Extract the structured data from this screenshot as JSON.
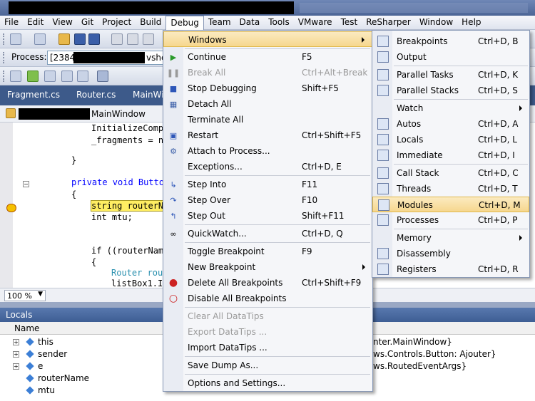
{
  "menubar": [
    "File",
    "Edit",
    "View",
    "Git",
    "Project",
    "Build",
    "Debug",
    "Team",
    "Data",
    "Tools",
    "VMware",
    "Test",
    "ReSharper",
    "Window",
    "Help"
  ],
  "process": {
    "label": "Process:",
    "value": "[2384]",
    "suffix": "vshc"
  },
  "doc_tabs": [
    "Fragment.cs",
    "Router.cs",
    "MainWi"
  ],
  "editor": {
    "nav_label": "MainWindow",
    "lines": [
      "InitializeComp",
      "_fragments = n",
      "}",
      "private void Butto",
      "{",
      "string routerN",
      "int mtu;",
      "if ((routerNam",
      "{",
      "Router rou",
      "listBox1.I"
    ],
    "zoom": "100 %"
  },
  "debug_menu": {
    "items": [
      {
        "label": "Windows",
        "shortcut": "",
        "icon": "",
        "submenu": true,
        "highlight": true,
        "disabled": false
      },
      {
        "label": "Continue",
        "shortcut": "F5",
        "icon": "play-icon",
        "disabled": false
      },
      {
        "label": "Break All",
        "shortcut": "Ctrl+Alt+Break",
        "icon": "pause-icon",
        "disabled": true
      },
      {
        "label": "Stop Debugging",
        "shortcut": "Shift+F5",
        "icon": "stop-icon",
        "disabled": false
      },
      {
        "label": "Detach All",
        "shortcut": "",
        "icon": "detach-icon",
        "disabled": false
      },
      {
        "label": "Terminate All",
        "shortcut": "",
        "icon": "",
        "disabled": false
      },
      {
        "label": "Restart",
        "shortcut": "Ctrl+Shift+F5",
        "icon": "restart-icon",
        "disabled": false
      },
      {
        "label": "Attach to Process...",
        "shortcut": "",
        "icon": "attach-icon",
        "disabled": false
      },
      {
        "label": "Exceptions...",
        "shortcut": "Ctrl+D, E",
        "icon": "",
        "disabled": false
      },
      {
        "label": "Step Into",
        "shortcut": "F11",
        "icon": "step-into-icon",
        "disabled": false
      },
      {
        "label": "Step Over",
        "shortcut": "F10",
        "icon": "step-over-icon",
        "disabled": false
      },
      {
        "label": "Step Out",
        "shortcut": "Shift+F11",
        "icon": "step-out-icon",
        "disabled": false
      },
      {
        "label": "QuickWatch...",
        "shortcut": "Ctrl+D, Q",
        "icon": "glasses-icon",
        "disabled": false
      },
      {
        "label": "Toggle Breakpoint",
        "shortcut": "F9",
        "icon": "",
        "disabled": false
      },
      {
        "label": "New Breakpoint",
        "shortcut": "",
        "icon": "",
        "submenu": true,
        "disabled": false
      },
      {
        "label": "Delete All Breakpoints",
        "shortcut": "Ctrl+Shift+F9",
        "icon": "delete-breakpoints-icon",
        "disabled": false
      },
      {
        "label": "Disable All Breakpoints",
        "shortcut": "",
        "icon": "disable-breakpoints-icon",
        "disabled": false
      },
      {
        "label": "Clear All DataTips",
        "shortcut": "",
        "icon": "",
        "disabled": true
      },
      {
        "label": "Export DataTips ...",
        "shortcut": "",
        "icon": "",
        "disabled": true
      },
      {
        "label": "Import DataTips ...",
        "shortcut": "",
        "icon": "",
        "disabled": false
      },
      {
        "label": "Save Dump As...",
        "shortcut": "",
        "icon": "",
        "disabled": false
      },
      {
        "label": "Options and Settings...",
        "shortcut": "",
        "icon": "",
        "disabled": false
      }
    ]
  },
  "windows_menu": {
    "items": [
      {
        "label": "Breakpoints",
        "shortcut": "Ctrl+D, B"
      },
      {
        "label": "Output",
        "shortcut": ""
      },
      {
        "label": "Parallel Tasks",
        "shortcut": "Ctrl+D, K"
      },
      {
        "label": "Parallel Stacks",
        "shortcut": "Ctrl+D, S"
      },
      {
        "label": "Watch",
        "shortcut": "",
        "submenu": true
      },
      {
        "label": "Autos",
        "shortcut": "Ctrl+D, A"
      },
      {
        "label": "Locals",
        "shortcut": "Ctrl+D, L"
      },
      {
        "label": "Immediate",
        "shortcut": "Ctrl+D, I"
      },
      {
        "label": "Call Stack",
        "shortcut": "Ctrl+D, C"
      },
      {
        "label": "Threads",
        "shortcut": "Ctrl+D, T"
      },
      {
        "label": "Modules",
        "shortcut": "Ctrl+D, M",
        "highlight": true
      },
      {
        "label": "Processes",
        "shortcut": "Ctrl+D, P"
      },
      {
        "label": "Memory",
        "shortcut": "",
        "submenu": true
      },
      {
        "label": "Disassembly",
        "shortcut": ""
      },
      {
        "label": "Registers",
        "shortcut": "Ctrl+D, R"
      }
    ]
  },
  "locals": {
    "title": "Locals",
    "header": "Name",
    "rows": [
      {
        "name": "this",
        "value": "nter.MainWindow}",
        "expandable": true
      },
      {
        "name": "sender",
        "value": "ws.Controls.Button: Ajouter}",
        "expandable": true
      },
      {
        "name": "e",
        "value": "ws.RoutedEventArgs}",
        "expandable": true
      },
      {
        "name": "routerName",
        "value": "",
        "expandable": false
      },
      {
        "name": "mtu",
        "value": "",
        "expandable": false
      }
    ]
  }
}
